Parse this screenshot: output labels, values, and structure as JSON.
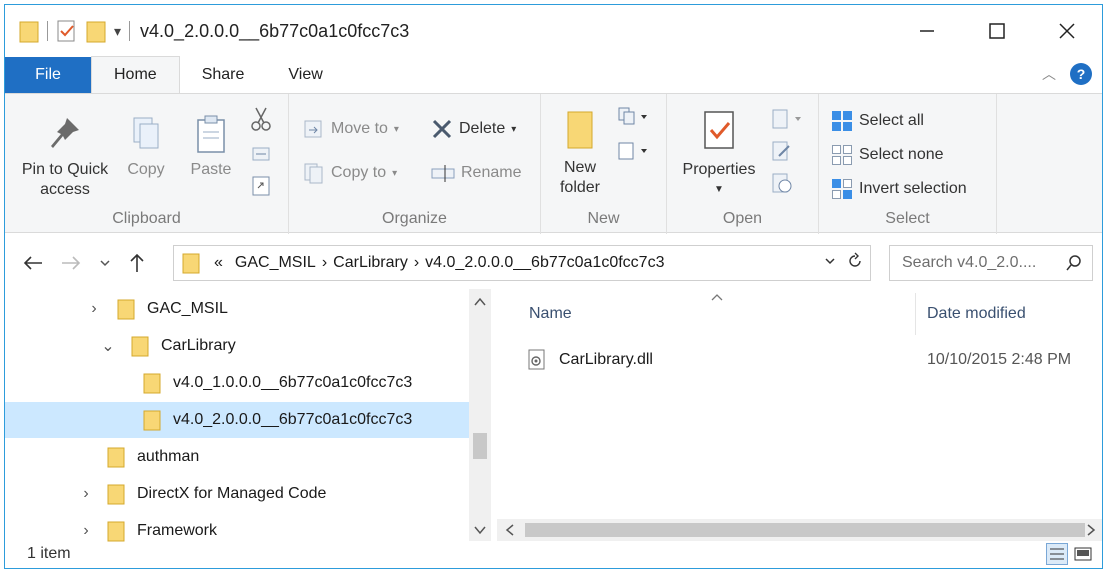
{
  "window": {
    "title": "v4.0_2.0.0.0__6b77c0a1c0fcc7c3"
  },
  "tabs": {
    "file": "File",
    "home": "Home",
    "share": "Share",
    "view": "View"
  },
  "ribbon": {
    "clipboard": {
      "pin": "Pin to Quick",
      "pin2": "access",
      "copy": "Copy",
      "paste": "Paste",
      "label": "Clipboard"
    },
    "organize": {
      "move_to": "Move to",
      "copy_to": "Copy to",
      "delete": "Delete",
      "rename": "Rename",
      "label": "Organize"
    },
    "new": {
      "new_folder": "New",
      "new_folder2": "folder",
      "label": "New"
    },
    "open": {
      "properties": "Properties",
      "label": "Open"
    },
    "select": {
      "select_all": "Select all",
      "select_none": "Select none",
      "invert": "Invert selection",
      "label": "Select"
    }
  },
  "address": {
    "overflow": "«",
    "crumbs": [
      "GAC_MSIL",
      "CarLibrary",
      "v4.0_2.0.0.0__6b77c0a1c0fcc7c3"
    ],
    "search_placeholder": "Search v4.0_2.0...."
  },
  "tree": [
    {
      "label": "GAC_MSIL",
      "expander": "›"
    },
    {
      "label": "CarLibrary",
      "expander": "⌄"
    },
    {
      "label": "v4.0_1.0.0.0__6b77c0a1c0fcc7c3",
      "expander": ""
    },
    {
      "label": "v4.0_2.0.0.0__6b77c0a1c0fcc7c3",
      "expander": ""
    },
    {
      "label": "authman",
      "expander": ""
    },
    {
      "label": "DirectX for Managed Code",
      "expander": "›"
    },
    {
      "label": "Framework",
      "expander": "›"
    }
  ],
  "columns": {
    "name": "Name",
    "date": "Date modified"
  },
  "files": [
    {
      "name": "CarLibrary.dll",
      "date": "10/10/2015 2:48 PM"
    }
  ],
  "status": {
    "count": "1 item"
  },
  "colors": {
    "accent": "#1f6fc4",
    "selection": "#cce8ff",
    "folder": "#f8d775"
  }
}
